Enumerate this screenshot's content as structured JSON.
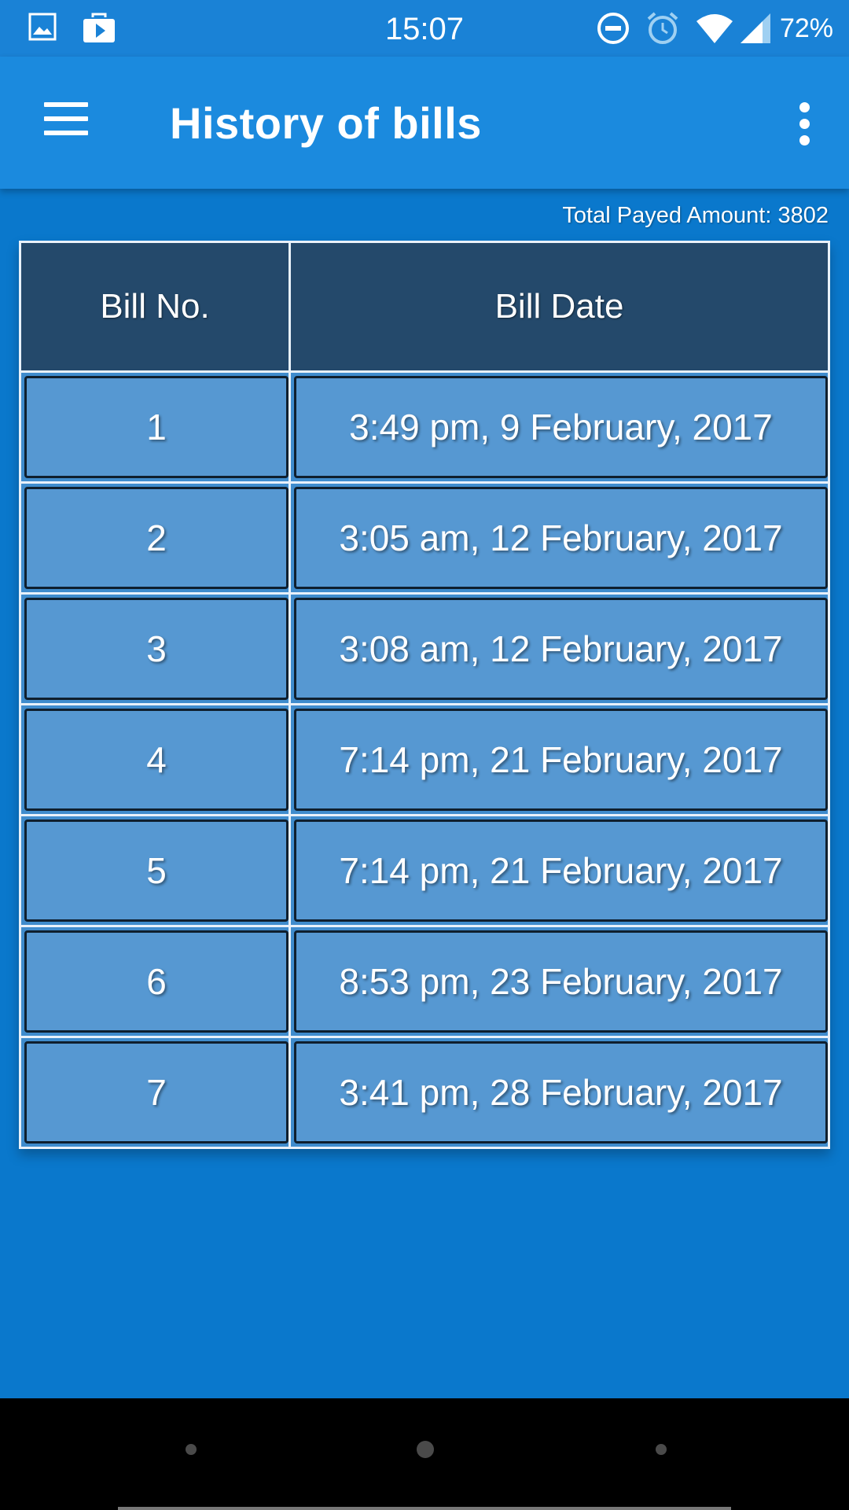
{
  "status_bar": {
    "time": "15:07",
    "battery": "72%",
    "icons": [
      "image-icon",
      "play-store-icon",
      "do-not-disturb-icon",
      "alarm-icon",
      "wifi-icon",
      "signal-icon"
    ]
  },
  "app_bar": {
    "title": "History of bills",
    "icons": [
      "menu-icon",
      "more-options-icon"
    ]
  },
  "summary": {
    "total_label": "Total Payed Amount: 3802"
  },
  "table": {
    "headers": [
      "Bill No.",
      "Bill Date"
    ],
    "rows": [
      {
        "bill_no": "1",
        "bill_date": "3:49 pm, 9 February, 2017"
      },
      {
        "bill_no": "2",
        "bill_date": "3:05 am, 12 February, 2017"
      },
      {
        "bill_no": "3",
        "bill_date": "3:08 am, 12 February, 2017"
      },
      {
        "bill_no": "4",
        "bill_date": "7:14 pm, 21 February, 2017"
      },
      {
        "bill_no": "5",
        "bill_date": "7:14 pm, 21 February, 2017"
      },
      {
        "bill_no": "6",
        "bill_date": "8:53 pm, 23 February, 2017"
      },
      {
        "bill_no": "7",
        "bill_date": "3:41 pm, 28 February, 2017"
      }
    ]
  },
  "colors": {
    "app_bar": "#1b8ade",
    "background": "#0a78cc",
    "header": "#24496b",
    "cell": "#5698d2"
  }
}
